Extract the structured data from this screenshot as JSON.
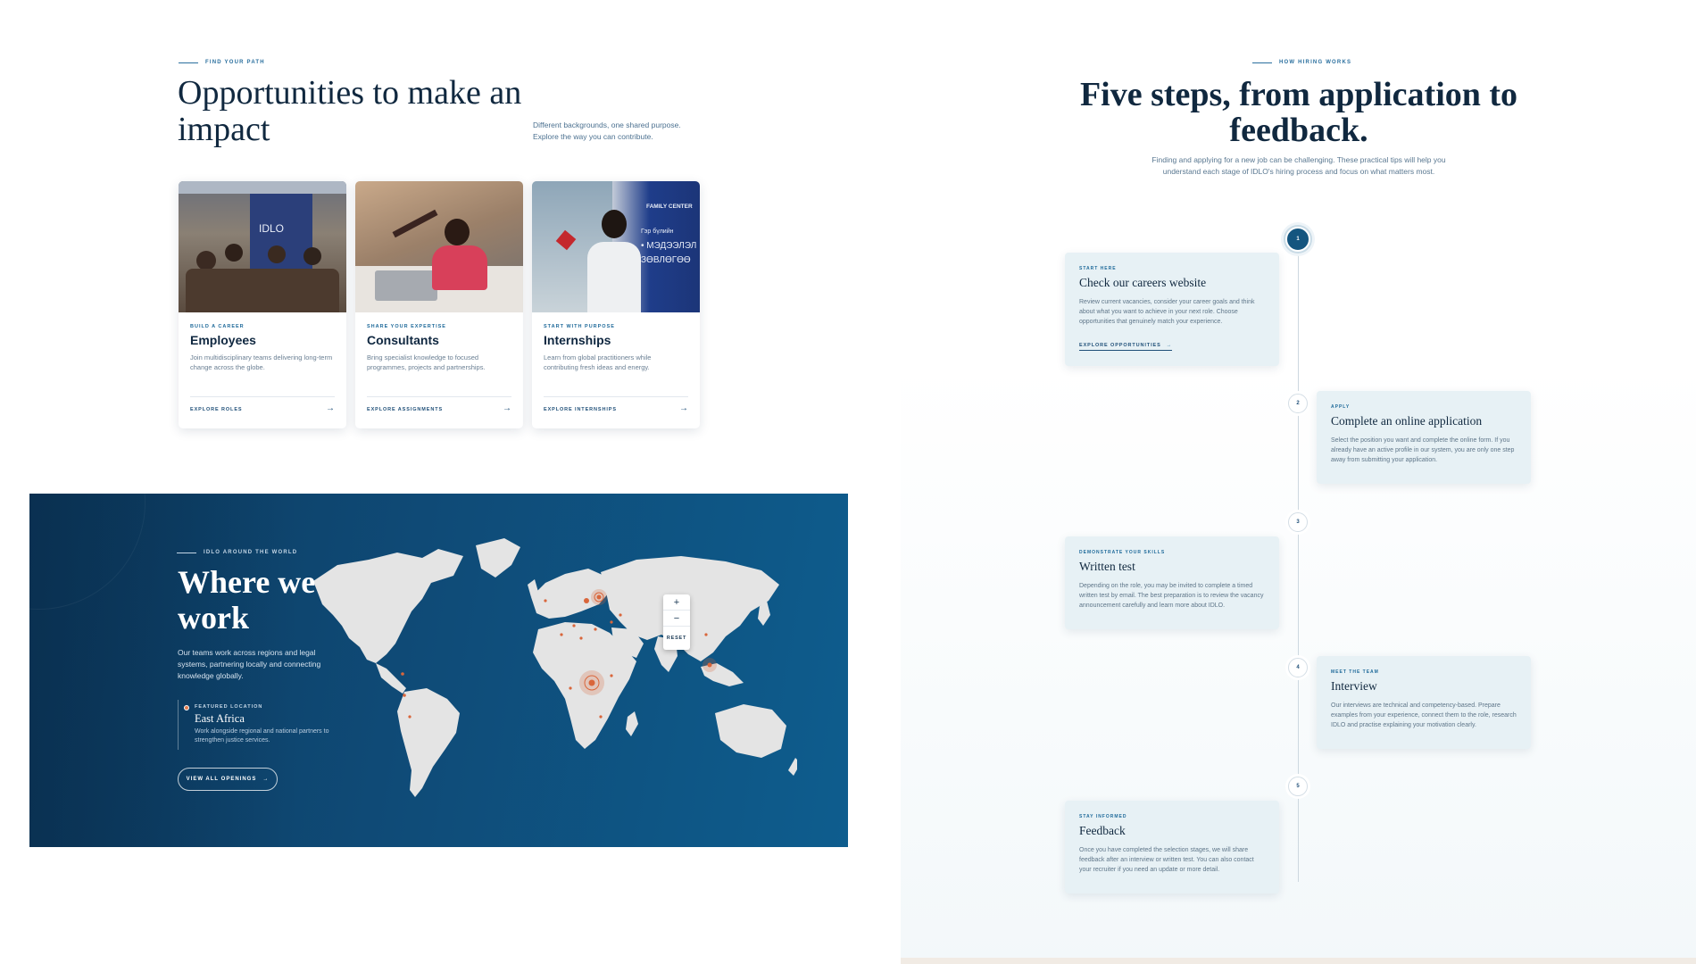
{
  "opportunities": {
    "eyebrow": "FIND YOUR PATH",
    "title": "Opportunities to make an impact",
    "subtitle": "Different backgrounds, one shared purpose. Explore the way you can contribute.",
    "cards": [
      {
        "eyebrow": "BUILD A CAREER",
        "title": "Employees",
        "description": "Join multidisciplinary teams delivering long-term change across the globe.",
        "link": "EXPLORE ROLES",
        "photo_banner": "IDLO"
      },
      {
        "eyebrow": "SHARE YOUR EXPERTISE",
        "title": "Consultants",
        "description": "Bring specialist knowledge to focused programmes, projects and partnerships.",
        "link": "EXPLORE ASSIGNMENTS"
      },
      {
        "eyebrow": "START WITH PURPOSE",
        "title": "Internships",
        "description": "Learn from global practitioners while contributing fresh ideas and energy.",
        "link": "EXPLORE INTERNSHIPS",
        "photo_banner": "FAMILY CENTER",
        "photo_sign": [
          "Гэр бүлийн",
          "• МЭДЭЭЛЭЛ",
          "ЗӨВЛӨГӨӨ",
          "ЗӨВЛӨГӨӨ",
          "ЗӨВЛӨГӨӨ"
        ]
      }
    ],
    "arrow_icon": "→"
  },
  "map_section": {
    "eyebrow": "IDLO AROUND THE WORLD",
    "title": "Where we work",
    "description": "Our teams work across regions and legal systems, partnering locally and connecting knowledge globally.",
    "featured": {
      "label": "FEATURED LOCATION",
      "name": "East Africa",
      "description": "Work alongside regional and national partners to strengthen justice services."
    },
    "button": "VIEW ALL OPENINGS",
    "button_arrow": "→",
    "controls": {
      "zoom_in": "+",
      "zoom_out": "−",
      "reset": "RESET"
    },
    "colors": {
      "panel": "#0f4a76",
      "land": "#e4e4e4",
      "marker": "#d9663b"
    }
  },
  "steps_section": {
    "eyebrow": "HOW HIRING WORKS",
    "title": "Five steps, from application to feedback.",
    "intro": "Finding and applying for a new job can be challenging. These practical tips will help you understand each stage of IDLO's hiring process and focus on what matters most.",
    "steps": [
      {
        "number": "1",
        "eyebrow": "START HERE",
        "title": "Check our careers website",
        "description": "Review current vacancies, consider your career goals and think about what you want to achieve in your next role. Choose opportunities that genuinely match your experience.",
        "link": "EXPLORE OPPORTUNITIES",
        "link_arrow": "→"
      },
      {
        "number": "2",
        "eyebrow": "APPLY",
        "title": "Complete an online application",
        "description": "Select the position you want and complete the online form. If you already have an active profile in our system, you are only one step away from submitting your application."
      },
      {
        "number": "3",
        "eyebrow": "DEMONSTRATE YOUR SKILLS",
        "title": "Written test",
        "description": "Depending on the role, you may be invited to complete a timed written test by email. The best preparation is to review the vacancy announcement carefully and learn more about IDLO."
      },
      {
        "number": "4",
        "eyebrow": "MEET THE TEAM",
        "title": "Interview",
        "description": "Our interviews are technical and competency-based. Prepare examples from your experience, connect them to the role, research IDLO and practise explaining your motivation clearly."
      },
      {
        "number": "5",
        "eyebrow": "STAY INFORMED",
        "title": "Feedback",
        "description": "Once you have completed the selection stages, we will share feedback after an interview or written test. You can also contact your recruiter if you need an update or more detail."
      }
    ]
  }
}
